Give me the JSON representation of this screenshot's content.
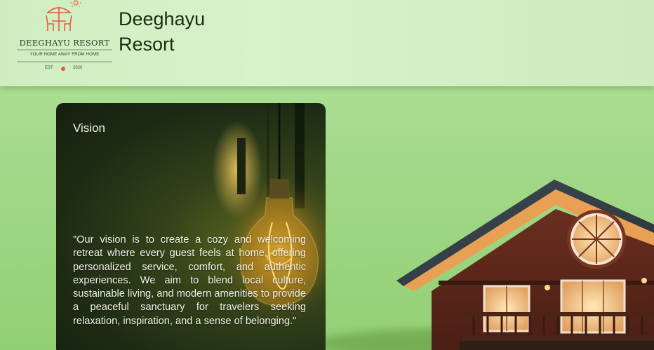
{
  "header": {
    "logo": {
      "name": "DEEGHAYU RESORT",
      "tagline": "YOUR HOME AWAY FROM HOME",
      "est": "EST",
      "year": "2020",
      "icon": "umbrella-table-chairs-icon",
      "accent_color": "#e35a45"
    },
    "brand_title": "Deeghayu Resort"
  },
  "vision": {
    "title": "Vision",
    "text": "\"Our vision is to create a cozy and welcoming retreat where every guest feels at home, offering personalized service, comfort, and authentic experiences. We aim to blend local culture, sustainable living, and modern amenities to provide a peaceful sanctuary for travelers seeking relaxation, inspiration, and a sense of belonging.\"",
    "background_image": "light-bulb-illustration"
  },
  "hero_image": "resort-house-illustration",
  "colors": {
    "page_background": "#a3d98a",
    "header_background": "#d8f2cb",
    "card_background": "#1d2b14"
  }
}
